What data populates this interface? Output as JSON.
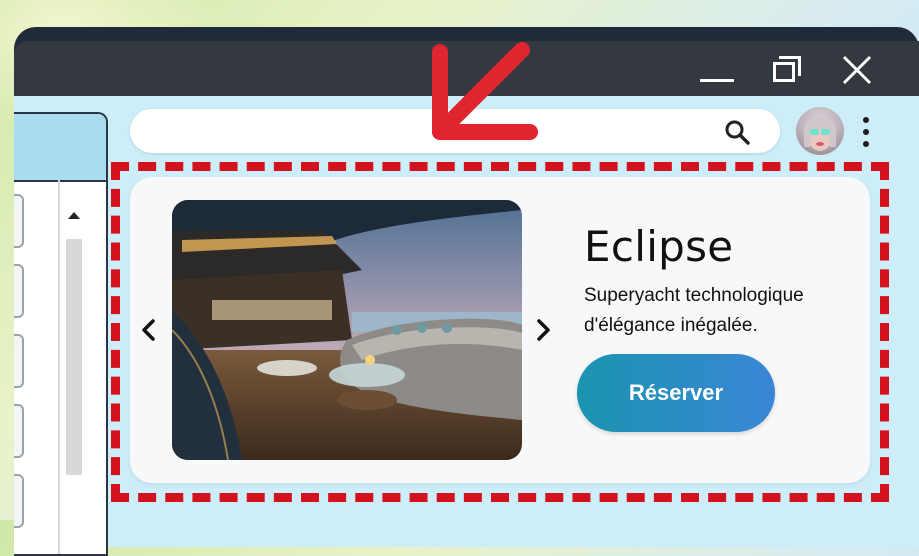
{
  "window": {
    "controls": {
      "minimize": "minimize",
      "maximize": "maximize",
      "close": "close"
    }
  },
  "search": {
    "placeholder": "",
    "value": "",
    "icon": "search-icon"
  },
  "avatar": {
    "icon": "avatar"
  },
  "menu": {
    "icon": "kebab-menu-icon"
  },
  "card": {
    "title": "Eclipse",
    "description": "Superyacht technologique d'élégance inégalée.",
    "button_label": "Réserver",
    "image_alt": "yacht-deck-photo",
    "prev_icon": "chevron-left-icon",
    "next_icon": "chevron-right-icon"
  },
  "colors": {
    "highlight": "#d4121e",
    "arrow": "#e02430",
    "button_start": "#1a94b0",
    "button_end": "#3a86d6",
    "content_bg": "#cdeef9"
  }
}
